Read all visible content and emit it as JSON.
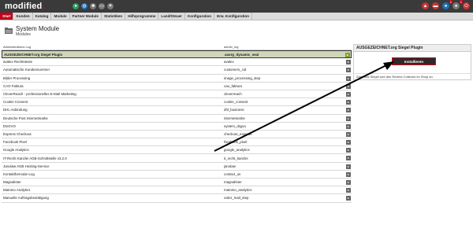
{
  "brand": {
    "name": "modified",
    "accent": "#c0001a"
  },
  "menu": [
    "Start",
    "Kunden",
    "Katalog",
    "Module",
    "Partner Module",
    "Statistiken",
    "Hilfsprogramme",
    "Land/Steuer",
    "Konfiguration",
    "Erw. Konfiguration"
  ],
  "page": {
    "title": "System Module",
    "subtitle": "Modules"
  },
  "table": {
    "headers": {
      "title": "Administrations Log",
      "code": "admin_log"
    },
    "rows": [
      {
        "title": "AUSGEZEICHNET.org Siegel Plugin",
        "code": "ausrg_dynamic_seal",
        "selected": true
      },
      {
        "title": "avalex Rechtstexte",
        "code": "avalex"
      },
      {
        "title": "Automatische Kundennummer",
        "code": "customers_cid"
      },
      {
        "title": "Bilder Processing",
        "code": "image_processing_step"
      },
      {
        "title": "CAO Faktura",
        "code": "cao_faktura"
      },
      {
        "title": "CleverReach - professionelles E-Mail Marketing",
        "code": "cleverreach"
      },
      {
        "title": "Cookie Consent",
        "code": "cookie_consent"
      },
      {
        "title": "DHL Anbindung",
        "code": "dhl_business"
      },
      {
        "title": "Deutsche Post Internetmarke",
        "code": "internetmarke"
      },
      {
        "title": "DSGVO",
        "code": "system_dsgvo"
      },
      {
        "title": "Express Checkout",
        "code": "checkout_express"
      },
      {
        "title": "Facebook Pixel",
        "code": "facebook_pixel"
      },
      {
        "title": "Google Analytics",
        "code": "google_analytics"
      },
      {
        "title": "IT-Recht Kanzlei AGB-Schnittstelle v3.2.0",
        "code": "it_recht_kanzlei"
      },
      {
        "title": "Janolaw AGB Hosting-Service",
        "code": "janolaw"
      },
      {
        "title": "Kontaktformular-Log",
        "code": "contact_us"
      },
      {
        "title": "Magnalister",
        "code": "magnalister"
      },
      {
        "title": "Matomo Analytics",
        "code": "matomo_analytics"
      },
      {
        "title": "Manuelle Auftragsbestätigung",
        "code": "order_mail_step"
      }
    ]
  },
  "side_panel": {
    "title": "AUSGEZEICHNET.org Siegel Plugin",
    "button": "Installieren",
    "description": "Zeigt das Siegel und den Review Collector im Shop an."
  },
  "icons": [
    "home-icon",
    "globe-icon",
    "user-icon",
    "mail-icon",
    "settings-icon"
  ],
  "colors": {
    "topbar": "#3a3a3a",
    "selected_row": "#cfd7b8",
    "button": "#2b2b2b",
    "highlight": "#e0001a"
  }
}
